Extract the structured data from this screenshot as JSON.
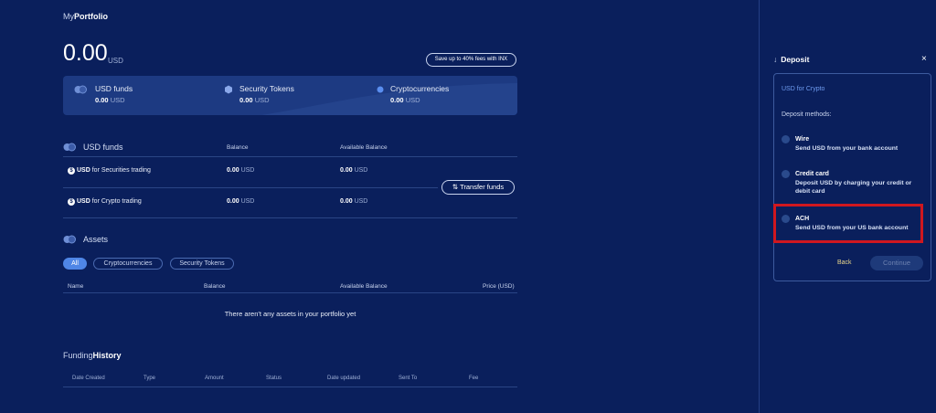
{
  "header": {
    "title_prefix": "My",
    "title_main": "Portfolio",
    "balance": "0.00",
    "balance_currency": "USD",
    "save_button": "Save up to 40% fees with INX"
  },
  "summary": [
    {
      "label": "USD funds",
      "value": "0.00",
      "currency": "USD",
      "icon": "coins-icon"
    },
    {
      "label": "Security Tokens",
      "value": "0.00",
      "currency": "USD",
      "icon": "hexagon-icon"
    },
    {
      "label": "Cryptocurrencies",
      "value": "0.00",
      "currency": "USD",
      "icon": "dot-icon"
    }
  ],
  "usd_funds": {
    "title": "USD funds",
    "col_balance": "Balance",
    "col_available": "Available Balance",
    "rows": [
      {
        "currency": "USD",
        "label": " for Securities trading",
        "balance": "0.00",
        "balance_cur": "USD",
        "available": "0.00",
        "available_cur": "USD"
      },
      {
        "currency": "USD",
        "label": " for Crypto trading",
        "balance": "0.00",
        "balance_cur": "USD",
        "available": "0.00",
        "available_cur": "USD"
      }
    ],
    "transfer_button": "Transfer funds"
  },
  "assets": {
    "title": "Assets",
    "filters": [
      "All",
      "Cryptocurrencies",
      "Security Tokens"
    ],
    "columns": [
      "Name",
      "Balance",
      "Available Balance",
      "Price (USD)"
    ],
    "empty_message": "There aren't any assets in your portfolio yet"
  },
  "history": {
    "title_prefix": "Funding",
    "title_main": "History",
    "columns": [
      "Date Created",
      "Type",
      "Amount",
      "Status",
      "Date updated",
      "Sent To",
      "Fee"
    ]
  },
  "deposit": {
    "title": "Deposit",
    "arrow": "↓",
    "close": "×",
    "subtitle": "USD for Crypto",
    "methods_label": "Deposit methods:",
    "options": [
      {
        "title": "Wire",
        "desc": "Send USD from your bank account"
      },
      {
        "title": "Credit card",
        "desc": "Deposit USD by charging your credit or debit card"
      },
      {
        "title": "ACH",
        "desc": "Send USD from your US bank account"
      }
    ],
    "back_button": "Back",
    "continue_button": "Continue"
  },
  "colors": {
    "background": "#0a1f5c",
    "accent": "#4f86e6",
    "highlight": "#d0171f"
  }
}
